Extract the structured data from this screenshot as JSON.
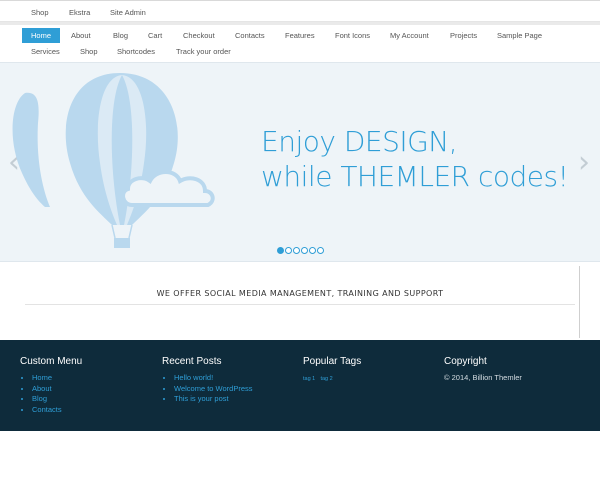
{
  "topbar": {
    "items": [
      "Shop",
      "Ekstra",
      "Site Admin"
    ]
  },
  "nav": {
    "row1": [
      "Home",
      "About",
      "Blog",
      "Cart",
      "Checkout",
      "Contacts",
      "Features",
      "Font Icons",
      "My Account",
      "Projects",
      "Sample Page"
    ],
    "row2": [
      "Services",
      "Shop",
      "Shortcodes",
      "Track your order"
    ],
    "active": "Home"
  },
  "slider": {
    "headline_line1": "Enjoy DESIGN,",
    "headline_line2": "while THEMLER codes!",
    "prev_arrow": "‹",
    "next_arrow": "›",
    "slide_count": 6,
    "active_slide": 1,
    "illustration": "hot-air-balloon-icon",
    "accent_color": "#2f9ed6"
  },
  "tagline": "WE OFFER SOCIAL MEDIA MANAGEMENT, TRAINING AND SUPPORT",
  "footer": {
    "custom_menu": {
      "title": "Custom Menu",
      "items": [
        "Home",
        "About",
        "Blog",
        "Contacts"
      ]
    },
    "recent_posts": {
      "title": "Recent Posts",
      "items": [
        "Hello world!",
        "Welcome to WordPress",
        "This is your post"
      ]
    },
    "popular_tags": {
      "title": "Popular Tags",
      "tags": [
        "tag 1",
        "tag 2"
      ]
    },
    "copyright": {
      "title": "Copyright",
      "text": "© 2014, Billion Themler"
    },
    "background_color": "#0e2b3b"
  }
}
